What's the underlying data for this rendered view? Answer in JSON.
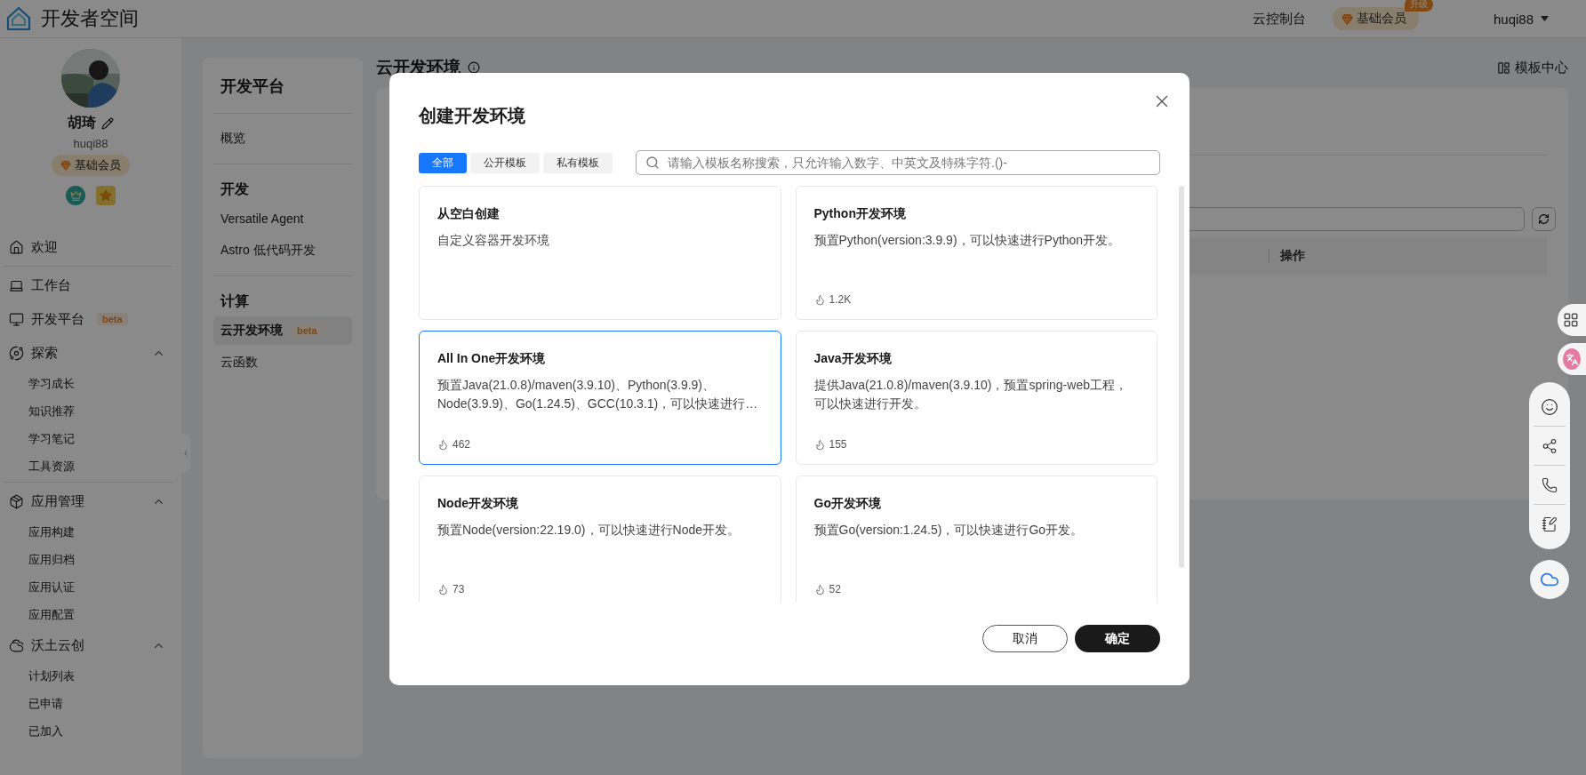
{
  "header": {
    "logo_text": "开发者空间",
    "console_link": "云控制台",
    "membership": {
      "label": "基础会员",
      "tag": "升级"
    },
    "user": "huqi88"
  },
  "profile": {
    "name": "胡琦",
    "username": "huqi88",
    "membership": "基础会员"
  },
  "nav_groups": [
    [
      {
        "label": "欢迎"
      }
    ],
    [
      {
        "label": "工作台"
      },
      {
        "label": "开发平台",
        "badge": "beta"
      },
      {
        "label": "探索",
        "expanded": true,
        "children": [
          "学习成长",
          "知识推荐",
          "学习笔记",
          "工具资源"
        ]
      }
    ],
    [
      {
        "label": "应用管理",
        "expanded": true,
        "children": [
          "应用构建",
          "应用归档",
          "应用认证",
          "应用配置"
        ]
      },
      {
        "label": "沃土云创",
        "expanded": true,
        "children": [
          "计划列表",
          "已申请",
          "已加入"
        ]
      }
    ]
  ],
  "platform_panel": {
    "title": "开发平台",
    "groups": [
      {
        "items": [
          {
            "label": "概览",
            "selected": false
          }
        ]
      },
      {
        "heading": "开发",
        "items": [
          {
            "label": "Versatile Agent",
            "selected": false
          },
          {
            "label": "Astro 低代码开发",
            "selected": false
          }
        ]
      },
      {
        "heading": "计算",
        "items": [
          {
            "label": "云开发环境",
            "badge": "beta",
            "selected": true
          },
          {
            "label": "云函数",
            "selected": false
          }
        ]
      }
    ]
  },
  "main": {
    "title": "云开发环境",
    "template_center": "模板中心",
    "table_columns": [
      "操作"
    ]
  },
  "modal": {
    "title": "创建开发环境",
    "tabs": [
      {
        "label": "全部",
        "selected": true
      },
      {
        "label": "公开模板",
        "selected": false
      },
      {
        "label": "私有模板",
        "selected": false
      }
    ],
    "search": {
      "placeholder": "请输入模板名称搜索，只允许输入数字、中英文及特殊字符.()-"
    },
    "templates": [
      {
        "title": "从空白创建",
        "description": "自定义容器开发环境",
        "selected": false
      },
      {
        "title": "Python开发环境",
        "description": "预置Python(version:3.9.9)，可以快速进行Python开发。",
        "uses": "1.2K",
        "selected": false
      },
      {
        "title": "All In One开发环境",
        "description": "预置Java(21.0.8)/maven(3.9.10)、Python(3.9.9)、Node(3.9.9)、Go(1.24.5)、GCC(10.3.1)，可以快速进行…",
        "uses": "462",
        "selected": true
      },
      {
        "title": "Java开发环境",
        "description": "提供Java(21.0.8)/maven(3.9.10)，预置spring-web工程，可以快速进行开发。",
        "uses": "155",
        "selected": false
      },
      {
        "title": "Node开发环境",
        "description": "预置Node(version:22.19.0)，可以快速进行Node开发。",
        "uses": "73",
        "selected": false
      },
      {
        "title": "Go开发环境",
        "description": "预置Go(version:1.24.5)，可以快速进行Go开发。",
        "uses": "52",
        "selected": false
      }
    ],
    "buttons": {
      "cancel": "取消",
      "confirm": "确定"
    }
  }
}
